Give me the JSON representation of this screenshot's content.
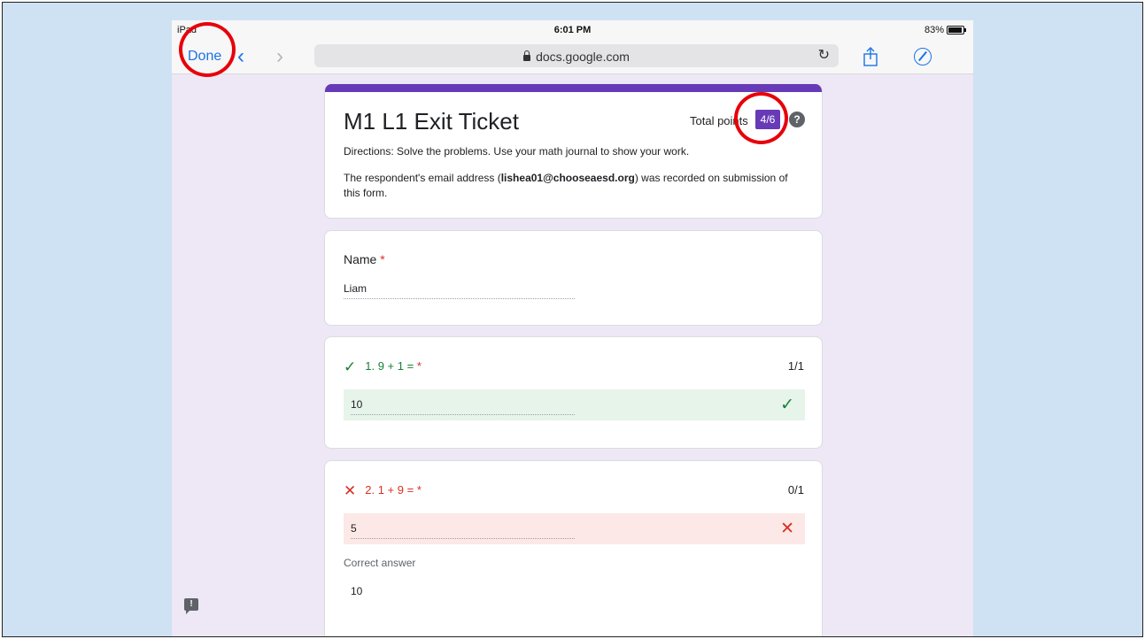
{
  "status_bar": {
    "device": "iPad",
    "time": "6:01 PM",
    "battery": "83%",
    "battery_level": 0.83
  },
  "browser": {
    "done_label": "Done",
    "back_icon": "chevron-left-icon",
    "forward_icon": "chevron-right-icon",
    "url": "docs.google.com",
    "reload_icon": "reload-icon",
    "share_icon": "share-icon",
    "compass_icon": "compass-icon"
  },
  "form": {
    "title": "M1 L1 Exit Ticket",
    "total_points_label": "Total points",
    "score": "4/6",
    "help_glyph": "?",
    "directions": "Directions:  Solve the problems.  Use your math journal to show your work.",
    "email_prefix": "The respondent's email address (",
    "email": "lishea01@chooseaesd.org",
    "email_suffix": ") was recorded on submission of this form.",
    "accent_color": "#673ab7"
  },
  "name_question": {
    "label": "Name",
    "required": "*",
    "answer": "Liam"
  },
  "questions": [
    {
      "label": "1. 9 + 1 =",
      "required": "*",
      "points": "1/1",
      "answer": "10",
      "status": "correct",
      "mark": "✓"
    },
    {
      "label": "2. 1 + 9 =",
      "required": "*",
      "points": "0/1",
      "answer": "5",
      "status": "incorrect",
      "mark": "✕",
      "correct_answer_label": "Correct answer",
      "correct_answer": "10"
    }
  ],
  "feedback_icon": "feedback-icon",
  "feedback_glyph": "!",
  "colors": {
    "correct": "#188038",
    "incorrect": "#d93025",
    "annotation": "#e8000a",
    "link": "#1a73e8"
  }
}
